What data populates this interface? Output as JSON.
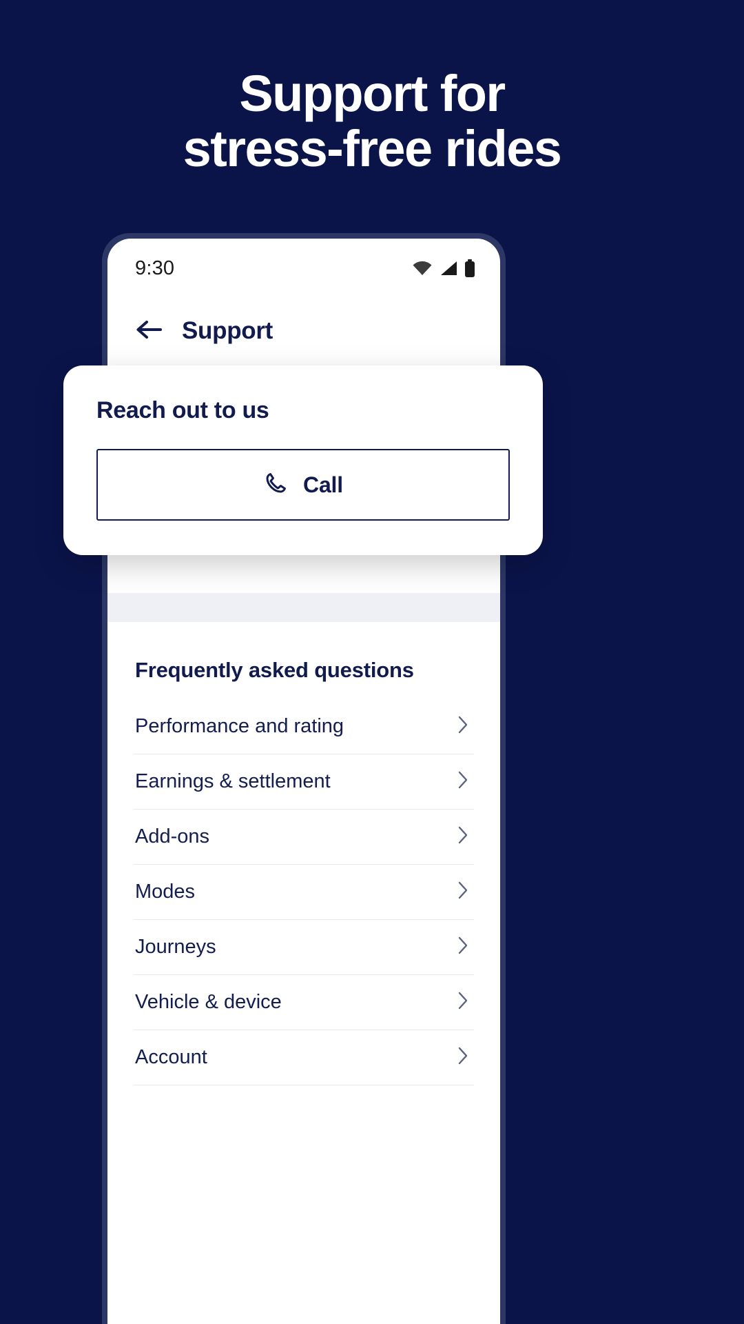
{
  "theme": {
    "background": "#0A1449",
    "navy": "#111B4E",
    "phone_bezel": "#2C3765",
    "screen": "#FFFFFF",
    "divider": "#E7E9EF",
    "grey_band": "#EEF0F5"
  },
  "promo": {
    "headline_line1": "Support for",
    "headline_line2": "stress-free rides"
  },
  "status_bar": {
    "time": "9:30",
    "icons": [
      "wifi-icon",
      "cellular-signal-icon",
      "battery-icon"
    ]
  },
  "app_header": {
    "back_icon": "arrow-left-icon",
    "title": "Support"
  },
  "contact_card": {
    "title": "Reach out to us",
    "call_button": {
      "label": "Call",
      "icon": "phone-icon"
    }
  },
  "faq": {
    "heading": "Frequently asked questions",
    "chevron_icon": "chevron-right-icon",
    "items": [
      {
        "label": "Performance and rating"
      },
      {
        "label": "Earnings & settlement"
      },
      {
        "label": "Add-ons"
      },
      {
        "label": "Modes"
      },
      {
        "label": "Journeys"
      },
      {
        "label": "Vehicle & device"
      },
      {
        "label": "Account"
      }
    ]
  }
}
